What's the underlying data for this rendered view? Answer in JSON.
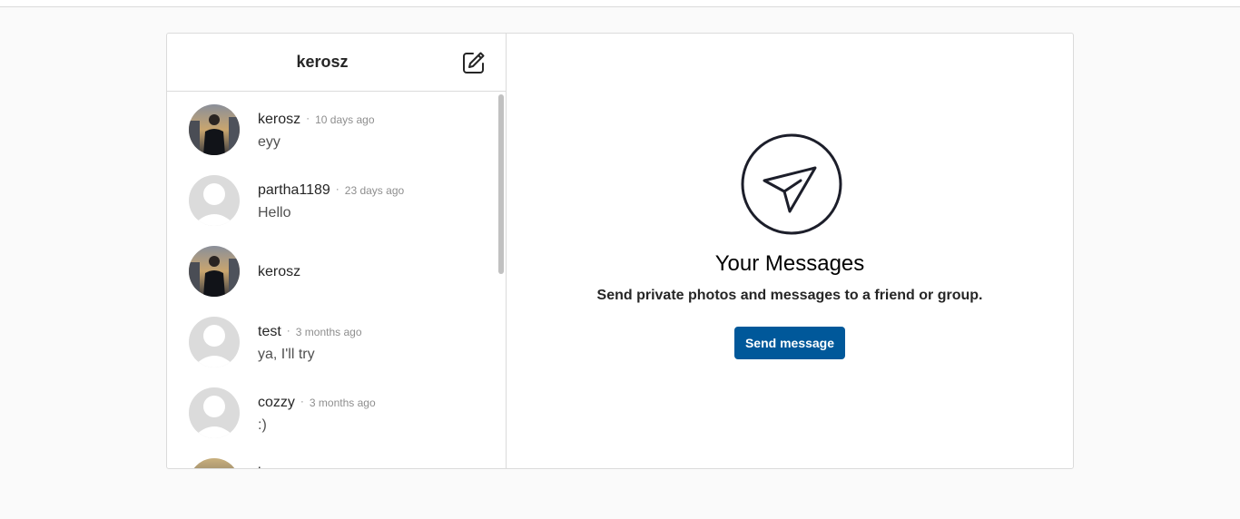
{
  "header": {
    "title": "kerosz"
  },
  "conversations": [
    {
      "name": "kerosz",
      "time": "10 days ago",
      "preview": "eyy",
      "avatar": "photo"
    },
    {
      "name": "partha1189",
      "time": "23 days ago",
      "preview": "Hello",
      "avatar": "default"
    },
    {
      "name": "kerosz",
      "time": "",
      "preview": "",
      "avatar": "photo"
    },
    {
      "name": "test",
      "time": "3 months ago",
      "preview": "ya, I'll try",
      "avatar": "default"
    },
    {
      "name": "cozzy",
      "time": "3 months ago",
      "preview": ":)",
      "avatar": "default"
    },
    {
      "name": "k",
      "time": "",
      "preview": "",
      "avatar": "photo"
    }
  ],
  "separator": "·",
  "main": {
    "title": "Your Messages",
    "subtitle": "Send private photos and messages to a friend or group.",
    "button_label": "Send message"
  },
  "icons": {
    "compose": "compose-icon",
    "empty_state": "paper-plane-icon"
  },
  "colors": {
    "button": "#00589a",
    "border": "#dbdbdb",
    "background": "#fafafa"
  }
}
